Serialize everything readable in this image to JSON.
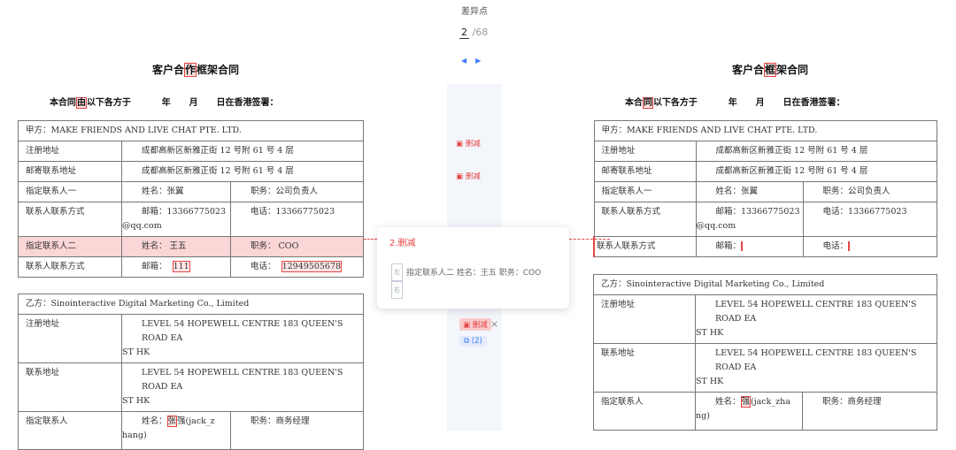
{
  "nav": {
    "title": "差异点",
    "current_page": "2",
    "total": " /68",
    "prev_icon": "◀",
    "next_icon": "▶",
    "tags": [
      "删减",
      "删减"
    ],
    "active_tag": "删减",
    "close_icon": "×",
    "copy_badge": "(2)"
  },
  "popup": {
    "title": "2.删减",
    "body_icon": "左",
    "body_text": "指定联系人二 姓名：王五 职务：COO",
    "body_icon2": "右"
  },
  "left": {
    "title_pre": "客户合",
    "title_hl": "作",
    "title_post": "框架合同",
    "intro_pre": "本合同",
    "intro_hl": "由",
    "intro_post": "以下各方于          年      月      日在香港签署：",
    "party_a": {
      "header": "甲方：MAKE FRIENDS AND LIVE CHAT PTE. LTD.",
      "reg_label": "注册地址",
      "reg_value": "成都高新区新雅正街 12 号附 61 号 4 层",
      "mail_label": "邮寄联系地址",
      "mail_value": "成都高新区新雅正街 12 号附 61 号 4 层",
      "c1_label": "指定联系人一",
      "c1_name": "姓名：张翼",
      "c1_title": "职务：公司负责人",
      "cm1_label": "联系人联系方式",
      "cm1_email": "邮箱：13366775023",
      "cm1_email2": "@qq.com",
      "cm1_phone": "电话：13366775023",
      "c2_label": "指定联系人二",
      "c2_name": "姓名：  王五",
      "c2_title": "职务：  COO",
      "cm2_label": "联系人联系方式",
      "cm2_email_pre": "邮箱：",
      "cm2_email_hl": "111",
      "cm2_phone_pre": "电话：",
      "cm2_phone_hl": "12949505678"
    },
    "party_b": {
      "header": "乙方：Sinointeractive Digital Marketing Co., Limited",
      "reg_label": "注册地址",
      "reg_value": "LEVEL 54 HOPEWELL CENTRE 183 QUEEN'S ROAD EA",
      "reg_value2": "ST HK",
      "addr_label": "联系地址",
      "addr_value": "LEVEL 54 HOPEWELL CENTRE 183 QUEEN'S ROAD EA",
      "addr_value2": "ST HK",
      "contact_label": "指定联系人",
      "contact_pre": "姓名：",
      "contact_hl": "张",
      "contact_post": "强(jack_z",
      "contact_post2": "hang)",
      "contact_title": "职务：商务经理"
    }
  },
  "right": {
    "title_pre": "客户合",
    "title_hl": "框",
    "title_post": "架合同",
    "intro_pre": "本合",
    "intro_hl": "同",
    "intro_post": "以下各方于          年      月      日在香港签署：",
    "party_a": {
      "header": "甲方：MAKE FRIENDS AND LIVE CHAT PTE. LTD.",
      "reg_label": "注册地址",
      "reg_value": "成都高新区新雅正街 12 号附 61 号 4 层",
      "mail_label": "邮寄联系地址",
      "mail_value": "成都高新区新雅正街 12 号附 61 号 4 层",
      "c1_label": "指定联系人一",
      "c1_name": "姓名：张翼",
      "c1_title": "职务：公司负责人",
      "cm1_label": "联系人联系方式",
      "cm1_email": "邮箱：13366775023",
      "cm1_email2": "@qq.com",
      "cm1_phone": "电话：13366775023",
      "cm2_label": "联系人联系方式",
      "cm2_email": "邮箱：",
      "cm2_phone": "电话："
    },
    "party_b": {
      "header": "乙方：Sinointeractive Digital Marketing Co., Limited",
      "reg_label": "注册地址",
      "reg_value": "LEVEL 54 HOPEWELL CENTRE 183 QUEEN'S ROAD EA",
      "reg_value2": "ST HK",
      "addr_label": "联系地址",
      "addr_value": "LEVEL 54 HOPEWELL CENTRE 183 QUEEN'S ROAD EA",
      "addr_value2": "ST HK",
      "contact_label": "指定联系人",
      "contact_pre": "姓名：",
      "contact_hl": "强",
      "contact_post": "(jack_zha",
      "contact_post2": "ng)",
      "contact_title": "职务：商务经理"
    }
  },
  "colors": {
    "accent": "#3a7afe",
    "diff": "#e54545",
    "diff_bg": "#fde6e6"
  }
}
